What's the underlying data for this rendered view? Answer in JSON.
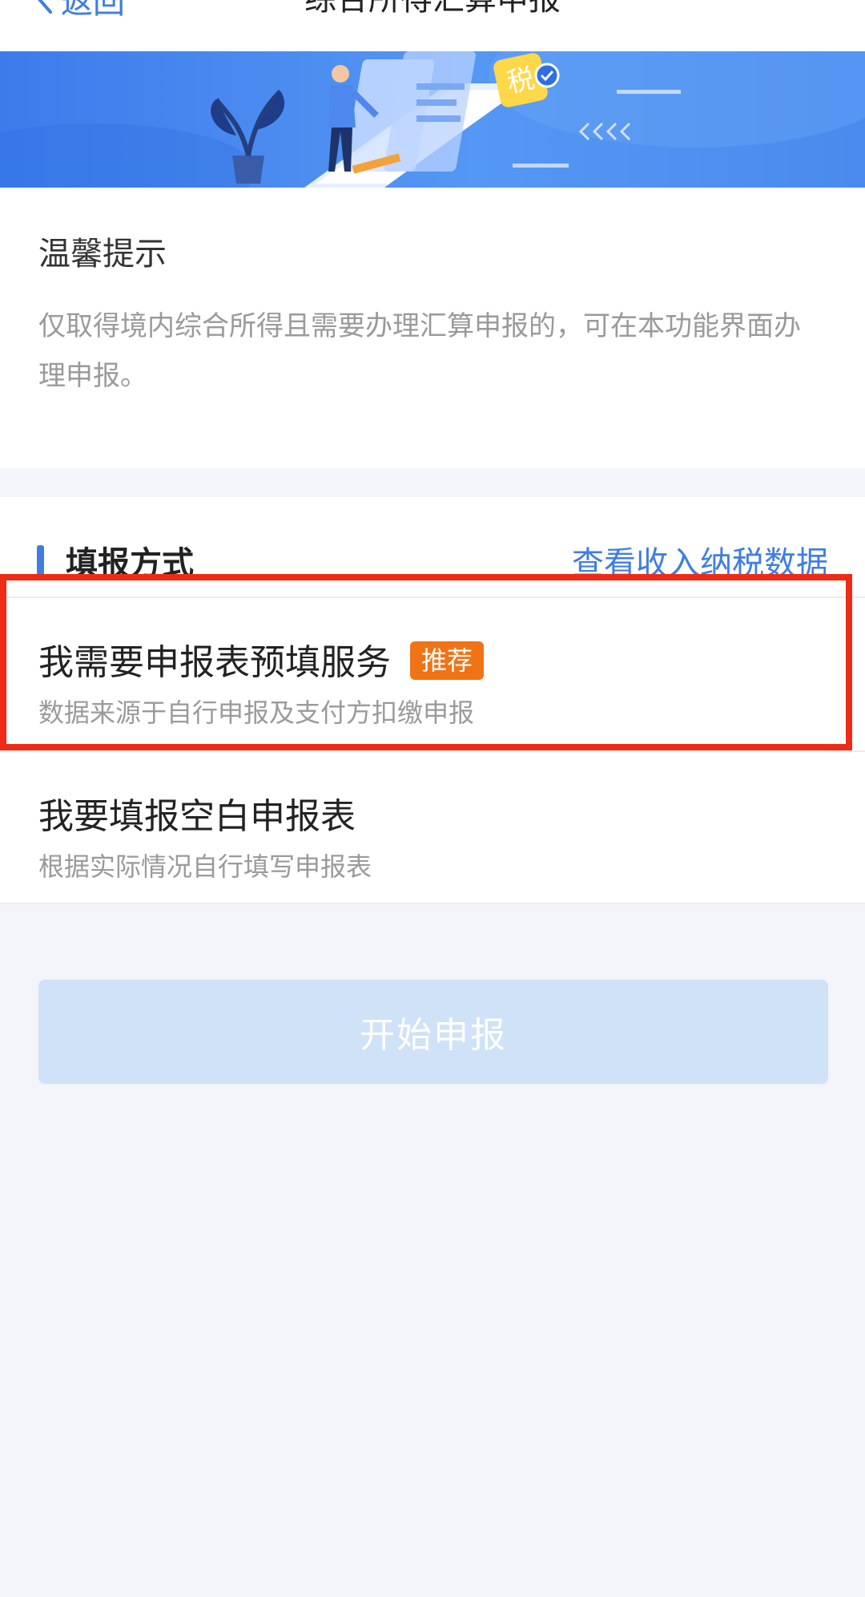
{
  "header": {
    "back_label": "返回",
    "title": "综合所得汇算申报"
  },
  "banner": {
    "tax_char": "税"
  },
  "tips": {
    "title": "温馨提示",
    "text": "仅取得境内综合所得且需要办理汇算申报的，可在本功能界面办理申报。"
  },
  "method": {
    "title": "填报方式",
    "link": "查看收入纳税数据",
    "options": [
      {
        "title": "我需要申报表预填服务",
        "badge": "推荐",
        "subtitle": "数据来源于自行申报及支付方扣缴申报"
      },
      {
        "title": "我要填报空白申报表",
        "subtitle": "根据实际情况自行填写申报表"
      }
    ]
  },
  "start_button": "开始申报",
  "colors": {
    "accent": "#3f7ee0",
    "badge": "#f07316",
    "highlight_border": "#ef2b16",
    "disabled_button": "#cfe2f8"
  }
}
